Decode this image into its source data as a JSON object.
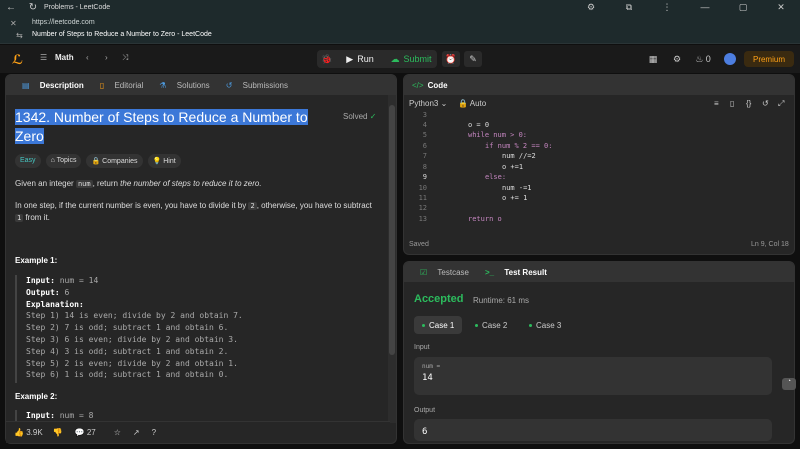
{
  "browser": {
    "tab_title": "Problems - LeetCode",
    "url": "https://leetcode.com",
    "page_title": "Number of Steps to Reduce a Number to Zero - LeetCode"
  },
  "nav": {
    "list_label": "Math",
    "run_label": "Run",
    "submit_label": "Submit",
    "fire_count": "0",
    "premium_label": "Premium"
  },
  "left_panel": {
    "tabs": [
      "Description",
      "Editorial",
      "Solutions",
      "Submissions"
    ],
    "title_line1": "1342. Number of Steps to Reduce a Number to",
    "title_line2": "Zero",
    "solved_label": "Solved",
    "tags": [
      "Easy",
      "Topics",
      "Companies",
      "Hint"
    ],
    "para1_pre": "Given an integer ",
    "para1_code": "num",
    "para1_mid": ", return ",
    "para1_em": "the number of steps to reduce it to zero.",
    "para2_pre": "In one step, if the current number is even, you have to divide it by ",
    "para2_code1": "2",
    "para2_mid": ", otherwise, you have to subtract ",
    "para2_code2": "1",
    "para2_post": " from it.",
    "example1_heading": "Example 1:",
    "example1": {
      "input_label": "Input:",
      "input_value": "num = 14",
      "output_label": "Output:",
      "output_value": "6",
      "explanation_label": "Explanation:",
      "steps": [
        "Step 1) 14 is even; divide by 2 and obtain 7.",
        "Step 2) 7 is odd; subtract 1 and obtain 6.",
        "Step 3) 6 is even; divide by 2 and obtain 3.",
        "Step 4) 3 is odd; subtract 1 and obtain 2.",
        "Step 5) 2 is even; divide by 2 and obtain 1.",
        "Step 6) 1 is odd; subtract 1 and obtain 0."
      ]
    },
    "example2_heading": "Example 2:",
    "example2_input_label": "Input:",
    "example2_input_value": "num = 8",
    "footer": {
      "likes": "3.9K",
      "comments": "27"
    }
  },
  "code_panel": {
    "header": "Code",
    "language": "Python3",
    "mode": "Auto",
    "lines": [
      {
        "n": "3",
        "text": ""
      },
      {
        "n": "4",
        "text": "o = 0"
      },
      {
        "n": "5",
        "text": "while num > 0:"
      },
      {
        "n": "6",
        "text": "if num % 2 == 0:"
      },
      {
        "n": "7",
        "text": "num //=2"
      },
      {
        "n": "8",
        "text": "o +=1"
      },
      {
        "n": "9",
        "text": "else:"
      },
      {
        "n": "10",
        "text": "num -=1"
      },
      {
        "n": "11",
        "text": "o += 1"
      },
      {
        "n": "12",
        "text": ""
      },
      {
        "n": "13",
        "text": "return o"
      }
    ],
    "status": "Saved",
    "position": "Ln 9, Col 18"
  },
  "result_panel": {
    "tab_testcase": "Testcase",
    "tab_result": "Test Result",
    "verdict": "Accepted",
    "runtime": "Runtime: 61 ms",
    "cases": [
      "Case 1",
      "Case 2",
      "Case 3"
    ],
    "input_label": "Input",
    "input_name": "num =",
    "input_value": "14",
    "output_label": "Output",
    "output_value": "6"
  },
  "colors": {
    "accent": "#ffa116",
    "accepted": "#2cbb5d",
    "easy": "#46c6c2",
    "highlight": "#3c78d8"
  }
}
